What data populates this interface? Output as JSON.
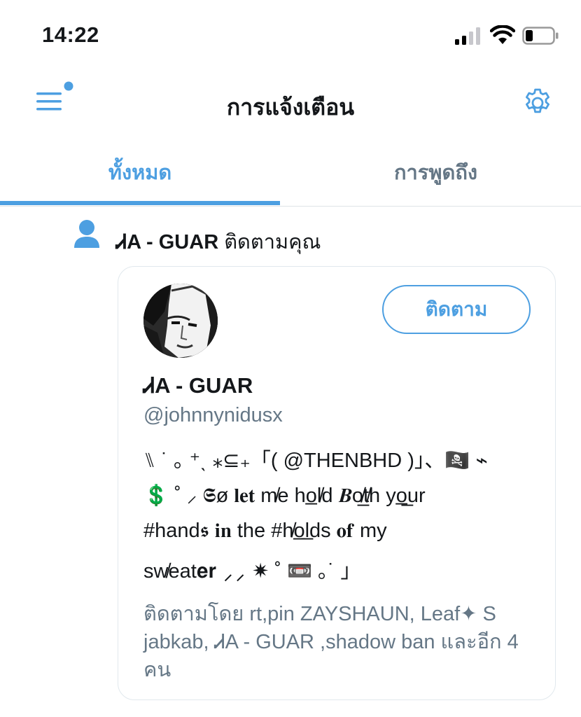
{
  "status_bar": {
    "time": "14:22"
  },
  "header": {
    "title": "การแจ้งเตือน"
  },
  "tabs": [
    {
      "label": "ทั้งหมด",
      "active": true
    },
    {
      "label": "การพูดถึง",
      "active": false
    }
  ],
  "notification": {
    "actor_name": "ᏗA - GUAR",
    "action_text": "ติดตามคุณ"
  },
  "profile_card": {
    "follow_label": "ติดตาม",
    "display_name": "ᏗA - GUAR",
    "handle": "@johnnynidusx",
    "bio_lines": [
      "⑊ ˙ ｡ ⁺ˎ ⁎⊆₊「( @THENBHD )」、🏴‍☠️ ⌁",
      "💲 ˚ ⸝ 𝕾ø 𝐥𝐞𝐭 m̸e ho̲l̸d 𝑩o̸̲t̸h yo̲̲ur",
      "#hand𝖘 𝐢𝐧 the #h̸o̲l̲ds 𝐨𝐟 my",
      "sw̸eat𝐞𝐫 ⸝⸝ ✷ ˚ 📼 ｡˙ 」"
    ],
    "followed_by": "ติดตามโดย rt,pin ZAYSHAUN, Leaf✦ S jabkab, ᏗA - GUAR ,shadow ban และอีก 4 คน"
  },
  "colors": {
    "accent": "#4d9fe1",
    "secondary_text": "#657786",
    "primary_text": "#14171a",
    "divider": "#dfe3e6"
  }
}
